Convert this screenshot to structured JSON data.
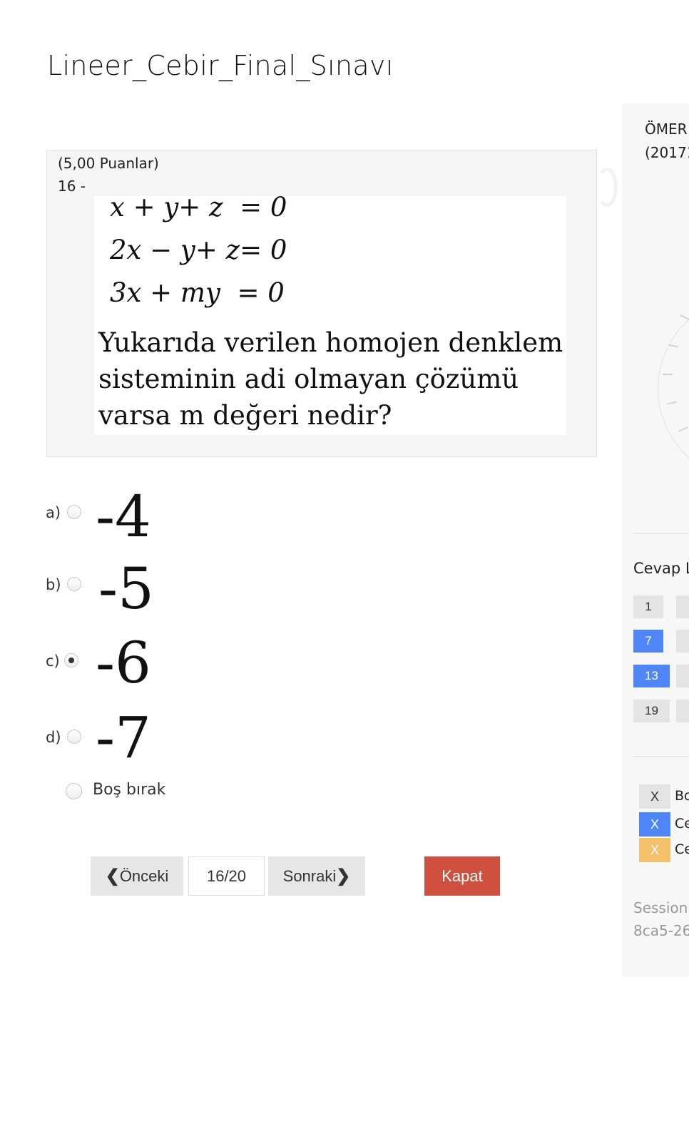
{
  "exam": {
    "title": "Lineer_Cebir_Final_Sınavı"
  },
  "question": {
    "points": "(5,00 Puanlar)",
    "number": "16 -",
    "equations": [
      "x + y+ z  = 0",
      "2x − y+ z= 0",
      "3x + my  = 0"
    ],
    "text": "Yukarıda verilen homojen denklem sisteminin adi olmayan çözümü varsa m değeri nedir?"
  },
  "options": [
    {
      "letter": "a)",
      "value": "-4",
      "selected": false
    },
    {
      "letter": "b)",
      "value": "-5",
      "selected": false
    },
    {
      "letter": "c)",
      "value": "-6",
      "selected": true
    },
    {
      "letter": "d)",
      "value": "-7",
      "selected": false
    }
  ],
  "skip": {
    "label": "Boş bırak",
    "selected": false
  },
  "navigation": {
    "prev_label": "Önceki",
    "page_indicator": "16/20",
    "next_label": "Sonraki",
    "close_label": "Kapat"
  },
  "sidebar": {
    "student_name": "ÖMER",
    "student_id": "(20171",
    "answer_list_title": "Cevap L",
    "question_buttons": [
      {
        "label": "1",
        "state": "unanswered"
      },
      {
        "label": "7",
        "state": "answered"
      },
      {
        "label": "13",
        "state": "answered"
      },
      {
        "label": "19",
        "state": "unanswered"
      }
    ],
    "legend": [
      {
        "mark": "X",
        "label": "Bo",
        "color": "#e4e4e4"
      },
      {
        "mark": "X",
        "label": "Ce",
        "color": "#4f86f7"
      },
      {
        "mark": "X",
        "label": "Ce",
        "color": "#f5c26b"
      }
    ],
    "session_label": "Session",
    "session_id": "8ca5-26"
  },
  "colors": {
    "answered": "#4f86f7",
    "close_button": "#d0503f",
    "legend_orange": "#f5c26b"
  },
  "icons": {
    "prev": "chevron-left-icon",
    "next": "chevron-right-icon"
  }
}
